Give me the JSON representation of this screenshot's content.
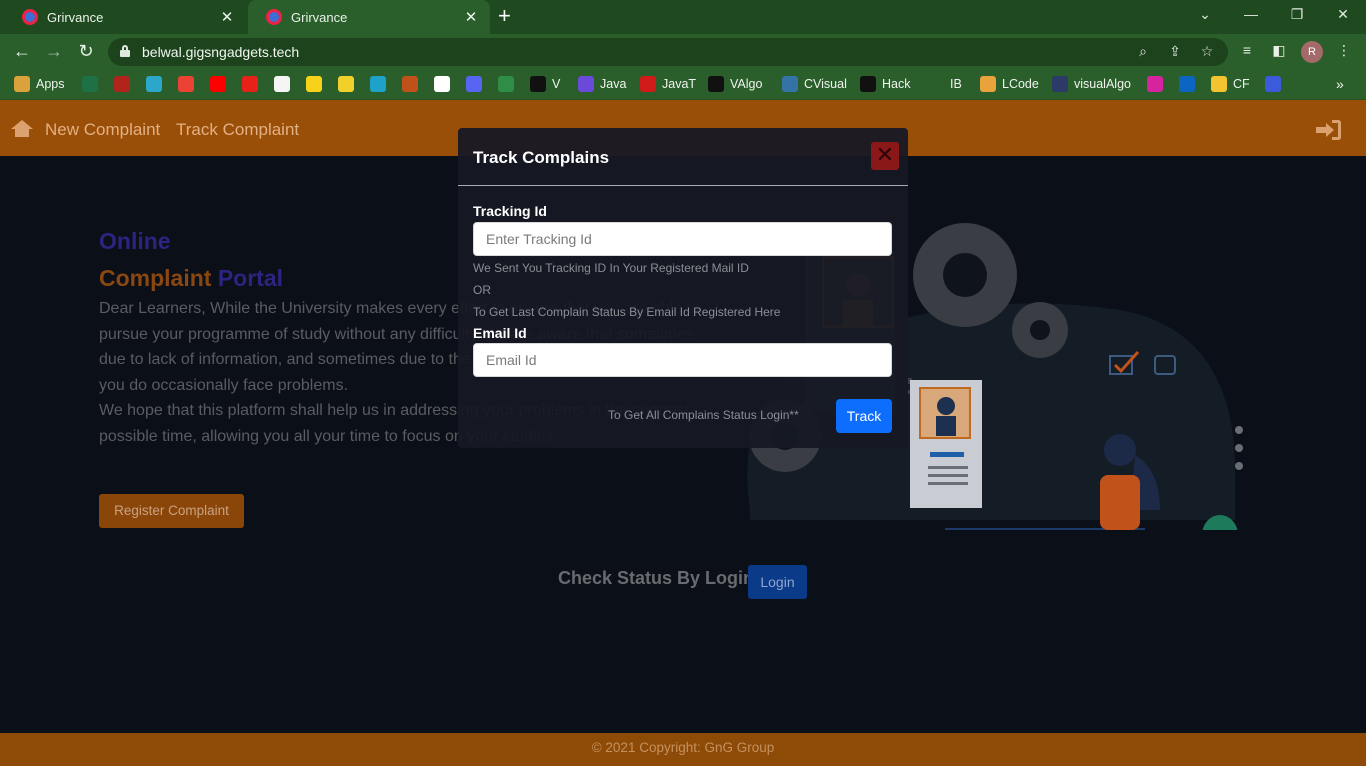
{
  "browser": {
    "tabs": [
      {
        "title": "Grirvance",
        "active": false
      },
      {
        "title": "Grirvance",
        "active": true
      }
    ],
    "new_tab_symbol": "+",
    "url": "belwal.gigsngadgets.tech",
    "profile_initial": "R",
    "bookmarks": [
      {
        "label": "Apps",
        "color": "#d9a23a"
      },
      {
        "label": "",
        "color": "#1e7145"
      },
      {
        "label": "",
        "color": "#b0241c"
      },
      {
        "label": "",
        "color": "#2aa7c9"
      },
      {
        "label": "",
        "color": "#ea4335"
      },
      {
        "label": "",
        "color": "#ff0000"
      },
      {
        "label": "",
        "color": "#e62117"
      },
      {
        "label": "",
        "color": "#f5f5f5"
      },
      {
        "label": "",
        "color": "#f7d21a"
      },
      {
        "label": "",
        "color": "#f2d02a"
      },
      {
        "label": "",
        "color": "#1ea2c9"
      },
      {
        "label": "",
        "color": "#c0511a"
      },
      {
        "label": "",
        "color": "#ffffff"
      },
      {
        "label": "",
        "color": "#5865f2"
      },
      {
        "label": "",
        "color": "#2f8d46"
      },
      {
        "label": "V",
        "color": "#111111"
      },
      {
        "label": "Java",
        "color": "#6c4ad9"
      },
      {
        "label": "JavaT",
        "color": "#d11a1a"
      },
      {
        "label": "VAlgo",
        "color": "#111111"
      },
      {
        "label": "CVisual",
        "color": "#3572a5"
      },
      {
        "label": "Hack",
        "color": "#111111"
      },
      {
        "label": "IB",
        "color": "#2a5e2a"
      },
      {
        "label": "LCode",
        "color": "#e8a33c"
      },
      {
        "label": "visualAlgo",
        "color": "#2b3a67"
      },
      {
        "label": "",
        "color": "#d6249f"
      },
      {
        "label": "",
        "color": "#0a66c2"
      },
      {
        "label": "CF",
        "color": "#f4c430"
      },
      {
        "label": "",
        "color": "#3b5bdb"
      }
    ],
    "more_symbol": "»"
  },
  "site": {
    "nav": {
      "new_complaint": "New Complaint",
      "track_complaint": "Track Complaint"
    },
    "hero": {
      "title_line1": "Online",
      "title_line2_a": "Complaint",
      "title_line2_b": "Portal",
      "paragraph1": "Dear Learners, While the University makes every effort to ensure that you are able to pursue your programme of study without any difficulty, we are aware that sometimes due to lack of information, and sometimes due to the sheer magnitude of operations, you do occasionally face problems.",
      "paragraph2": "We hope that this platform shall help us in addressing your problems in the shortest possible time, allowing you all your time to focus on your studies.",
      "register_button": "Register Complaint"
    },
    "check_status": {
      "label": "Check Status By Login",
      "button": "Login"
    },
    "footer": "© 2021 Copyright: GnG Group"
  },
  "modal": {
    "title": "Track Complains",
    "close_symbol": "✕",
    "tracking_label": "Tracking Id",
    "tracking_placeholder": "Enter Tracking Id",
    "hint_sent": "We Sent You Tracking ID In Your Registered Mail ID",
    "hint_or": "OR",
    "hint_email": "To Get Last Complain Status By Email Id Registered Here",
    "email_label": "Email Id",
    "email_placeholder": "Email Id",
    "login_note": "To Get All Complains Status Login**",
    "track_button": "Track"
  },
  "colors": {
    "browser_green": "#2a5e2a",
    "brand_orange": "#9a4f08",
    "accent_blue": "#0d6efd",
    "title_purple": "#2d2382"
  }
}
